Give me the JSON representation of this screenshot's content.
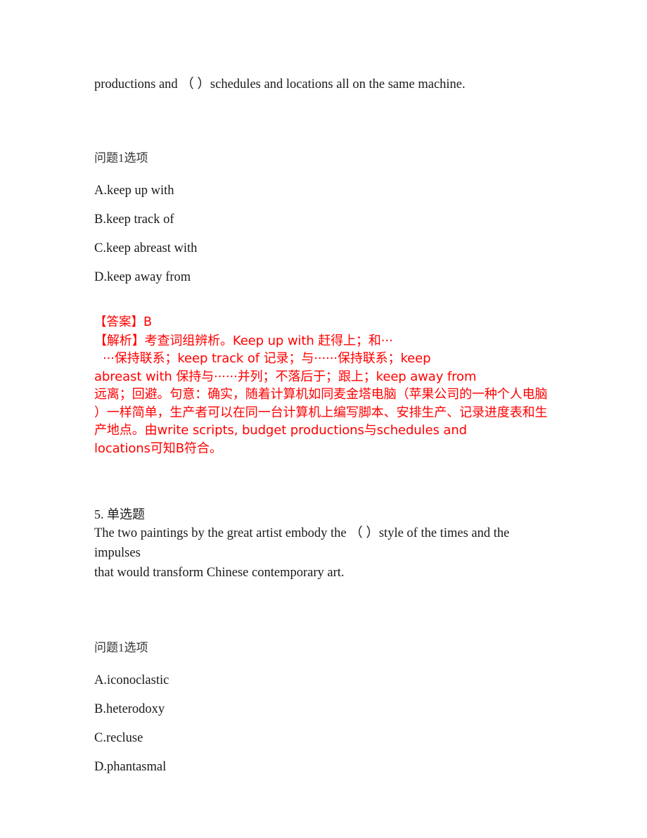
{
  "document": {
    "type": "exam-question-sheet",
    "accent_color": "#ff0000",
    "text_color": "#1a1a1a",
    "background_color": "#ffffff"
  },
  "question4_continuation": {
    "stem_tail": "productions and （ ）schedules and locations all on the same machine.",
    "options_label": "问题1选项",
    "options": [
      "A.keep up with",
      "B.keep track of",
      "C.keep abreast with",
      "D.keep away from"
    ],
    "answer": {
      "answer_line": "【答案】B",
      "explanation_lines": [
        "【解析】考查词组辨析。Keep up with 赶得上；和···",
        "···保持联系；keep track of 记录；与······保持联系；keep",
        "abreast with 保持与······并列；不落后于；跟上；keep away from",
        "远离；回避。句意：确实，随着计算机如同麦金塔电脑（苹果公司的一种个人电脑",
        "）一样简单，生产者可以在同一台计算机上编写脚本、安排生产、记录进度表和生",
        "产地点。由write scripts, budget productions与schedules and",
        "locations可知B符合。"
      ]
    }
  },
  "question5": {
    "number_and_type": "5. 单选题",
    "stem_line1": "The two paintings by the great artist embody the （ ）style of the times and the impulses",
    "stem_line2": "that would transform Chinese contemporary art.",
    "options_label": "问题1选项",
    "options": [
      "A.iconoclastic",
      "B.heterodoxy",
      "C.recluse",
      "D.phantasmal"
    ]
  }
}
